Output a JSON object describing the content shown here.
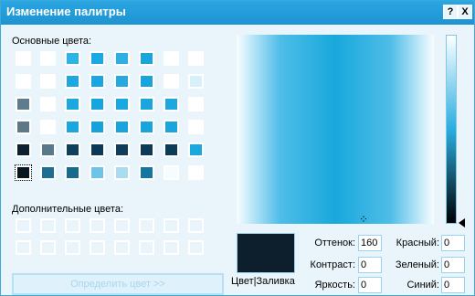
{
  "window": {
    "title": "Изменение палитры",
    "help_label": "?",
    "close_label": "X"
  },
  "labels": {
    "basic_colors": "Основные цвета:",
    "custom_colors": "Дополнительные цвета:",
    "color_solid": "Цвет|Заливка"
  },
  "basic_colors": [
    "#ffffff",
    "#ffffff",
    "#2db4e6",
    "#1aa9e2",
    "#2eb0e2",
    "#18a5de",
    "#ffffff",
    "#ffffff",
    "#ffffff",
    "#ffffff",
    "#1ea8df",
    "#1aa6e0",
    "#26a9df",
    "#18a4dd",
    "#ffffff",
    "#d8f0fa",
    "#607c8c",
    "#ffffff",
    "#1ba8df",
    "#16a5df",
    "#1aa8e0",
    "#1aa5de",
    "#1ea7de",
    "#ffffff",
    "#5e7886",
    "#ffffff",
    "#1aa6de",
    "#16a3dc",
    "#1aa4dd",
    "#1aa4dc",
    "#1ca4dc",
    "#ffffff",
    "#0e2030",
    "#58798a",
    "#0e3f5b",
    "#0c3a56",
    "#113d59",
    "#0f3a56",
    "#0d3c57",
    "#1aa8dd",
    "#07161f",
    "#1d6f91",
    "#176b8c",
    "#6cc4e8",
    "#aadcf0",
    "#1577a0",
    "#f7fdff",
    "#ffffff"
  ],
  "custom_colors_count": 16,
  "fields": {
    "hue_label": "Оттенок:",
    "hue": "160",
    "sat_label": "Контраст:",
    "sat": "0",
    "lum_label": "Яркость:",
    "lum": "0",
    "red_label": "Красный:",
    "red": "0",
    "green_label": "Зеленый:",
    "green": "0",
    "blue_label": "Синий:",
    "blue": "0"
  },
  "define_button": "Определить цвет >>",
  "crosshair_glyph": "⁘"
}
